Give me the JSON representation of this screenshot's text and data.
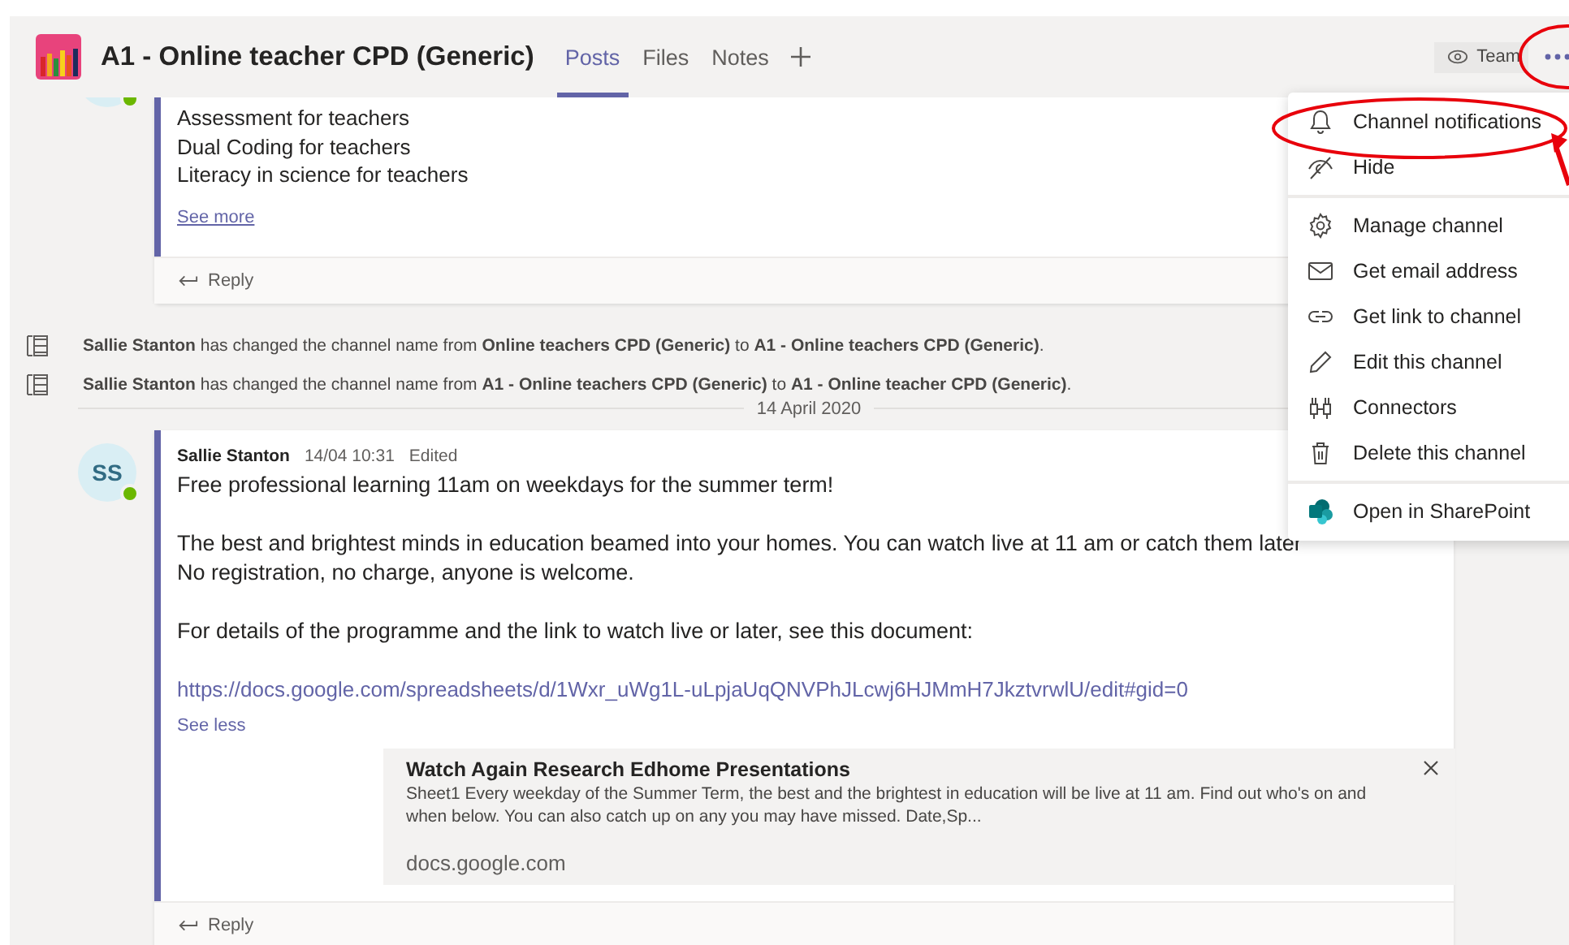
{
  "header": {
    "title": "A1 - Online teacher CPD (Generic)",
    "tabs": [
      {
        "label": "Posts",
        "selected": true
      },
      {
        "label": "Files",
        "selected": false
      },
      {
        "label": "Notes",
        "selected": false
      }
    ],
    "team_button": "Team"
  },
  "earlier_post": {
    "online": true,
    "lines": [
      "Assessment for teachers",
      "Dual Coding for teachers",
      "Literacy in science for teachers"
    ],
    "see_more": "See more",
    "reply": "Reply"
  },
  "system_messages": [
    {
      "text": "**Sallie Stanton** has changed the channel name from **Online teachers CPD (Generic)** to **A1 - Online teachers CPD (Generic)**."
    },
    {
      "text": "**Sallie Stanton** has changed the channel name from **A1 - Online teachers CPD (Generic)** to **A1 - Online teacher CPD (Generic)**."
    }
  ],
  "date_divider": "14 April 2020",
  "post": {
    "avatar": "SS",
    "online": true,
    "author": "Sallie Stanton",
    "time": "14/04 10:31",
    "edited": "Edited",
    "paragraphs": [
      [
        "Free professional learning 11am on weekdays for the summer term!"
      ],
      [
        "The best and brightest minds in education beamed into your homes. You can watch live at 11 am or catch them later",
        "No registration, no charge, anyone is welcome."
      ],
      [
        "For details of the programme and the link to watch live or later, see this document:"
      ]
    ],
    "link": "https://docs.google.com/spreadsheets/d/1Wxr_uWg1L-uLpjaUqQNVPhJLcwj6HJMmH7JkztvrwlU/edit#gid=0",
    "see_less": "See less",
    "preview": {
      "title": "Watch Again Research Edhome Presentations",
      "description": "Sheet1 Every weekday of the Summer Term, the best and the brightest in education will be live at 11 am. Find out who's on and when below. You can also catch up on any you may have missed. Date,Sp...",
      "domain": "docs.google.com"
    },
    "reply": "Reply"
  },
  "menu": {
    "sections": [
      [
        {
          "label": "Channel notifications"
        },
        {
          "label": "Hide"
        }
      ],
      [
        {
          "label": "Manage channel"
        },
        {
          "label": "Get email address"
        },
        {
          "label": "Get link to channel"
        },
        {
          "label": "Edit this channel"
        },
        {
          "label": "Connectors"
        },
        {
          "label": "Delete this channel"
        }
      ],
      [
        {
          "label": "Open in SharePoint"
        }
      ]
    ]
  }
}
